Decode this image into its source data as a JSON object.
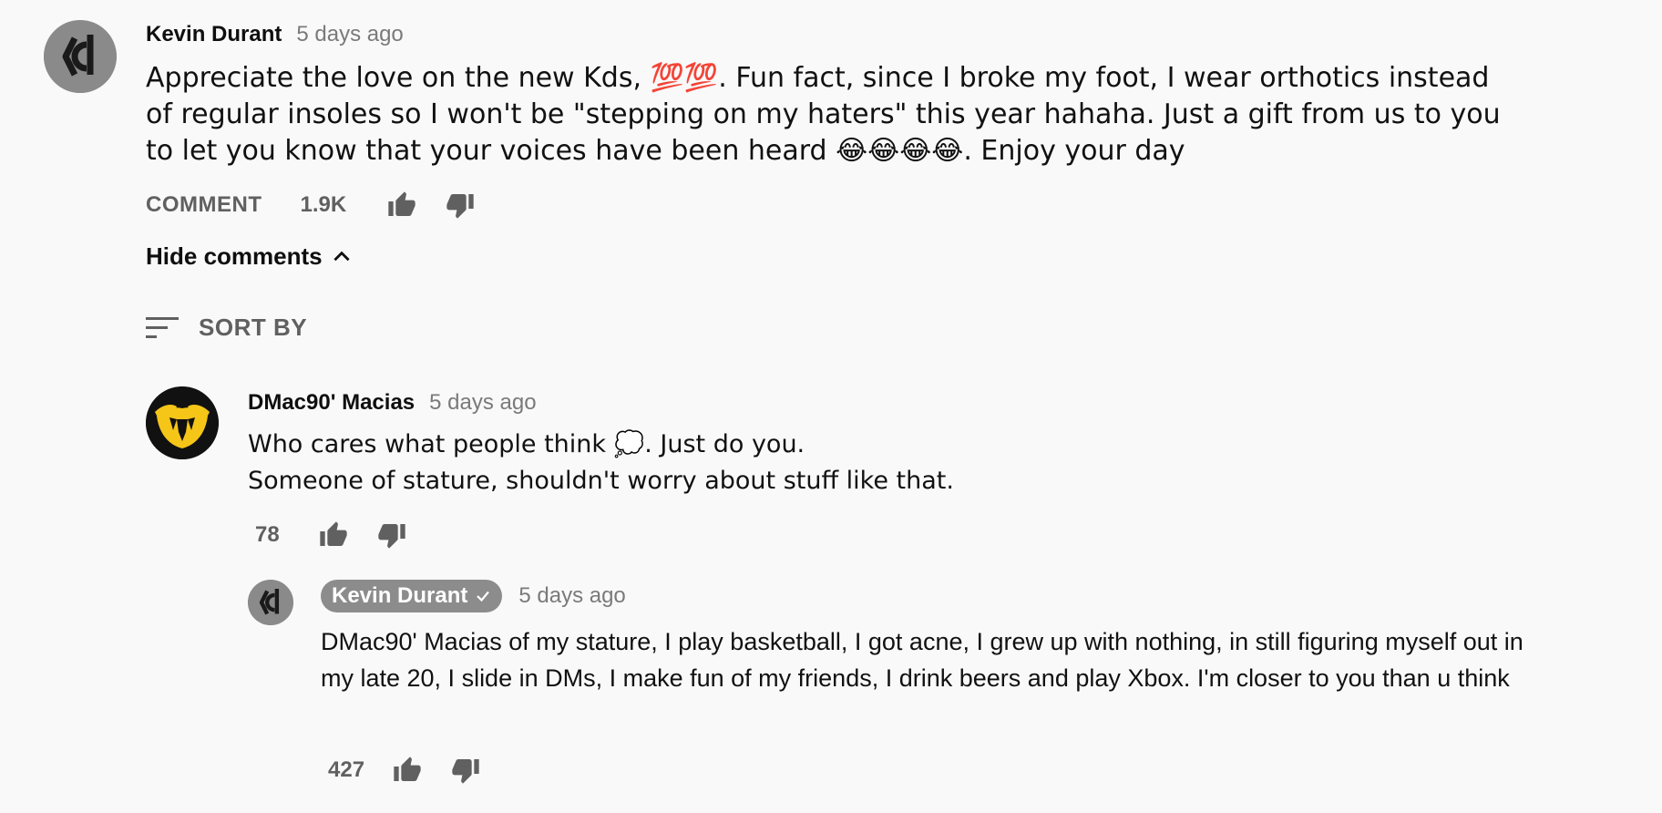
{
  "top_comment": {
    "author": "Kevin Durant",
    "time": "5 days ago",
    "text": "Appreciate the love on the new Kds, 💯💯. Fun fact, since I broke my foot, I wear orthotics instead of regular insoles so I won't be \"stepping on my haters\" this year hahaha. Just a gift from us to you to let you know that your voices have been heard 😂😂😂😂. Enjoy your day",
    "comment_label": "COMMENT",
    "likes": "1.9K"
  },
  "hide_comments_label": "Hide comments",
  "sort_by_label": "SORT BY",
  "reply1": {
    "author": "DMac90' Macias",
    "time": "5 days ago",
    "line1": "Who cares what people think 💭. Just do you.",
    "line2": "Someone of stature, shouldn't worry about stuff like that.",
    "likes": "78"
  },
  "reply2": {
    "author": "Kevin Durant",
    "time": "5 days ago",
    "text": "DMac90' Macias of my stature, I play basketball, I got acne, I grew up with nothing, in still figuring myself out in my late 20, I slide in DMs, I make fun of my friends, I drink beers and play Xbox. I'm closer to you than u think",
    "likes": "427"
  },
  "icons": {
    "like": "thumbs-up-icon",
    "dislike": "thumbs-down-icon",
    "chevron": "chevron-up-icon",
    "sort": "sort-icon",
    "verified": "checkmark-icon"
  },
  "colors": {
    "background": "#f9f9f9",
    "muted_text": "#606060",
    "timestamp": "#7a7a7a",
    "author_badge": "#8c8c8c",
    "avatar_gray": "#8a8a8a",
    "wu_yellow": "#f5c518"
  }
}
